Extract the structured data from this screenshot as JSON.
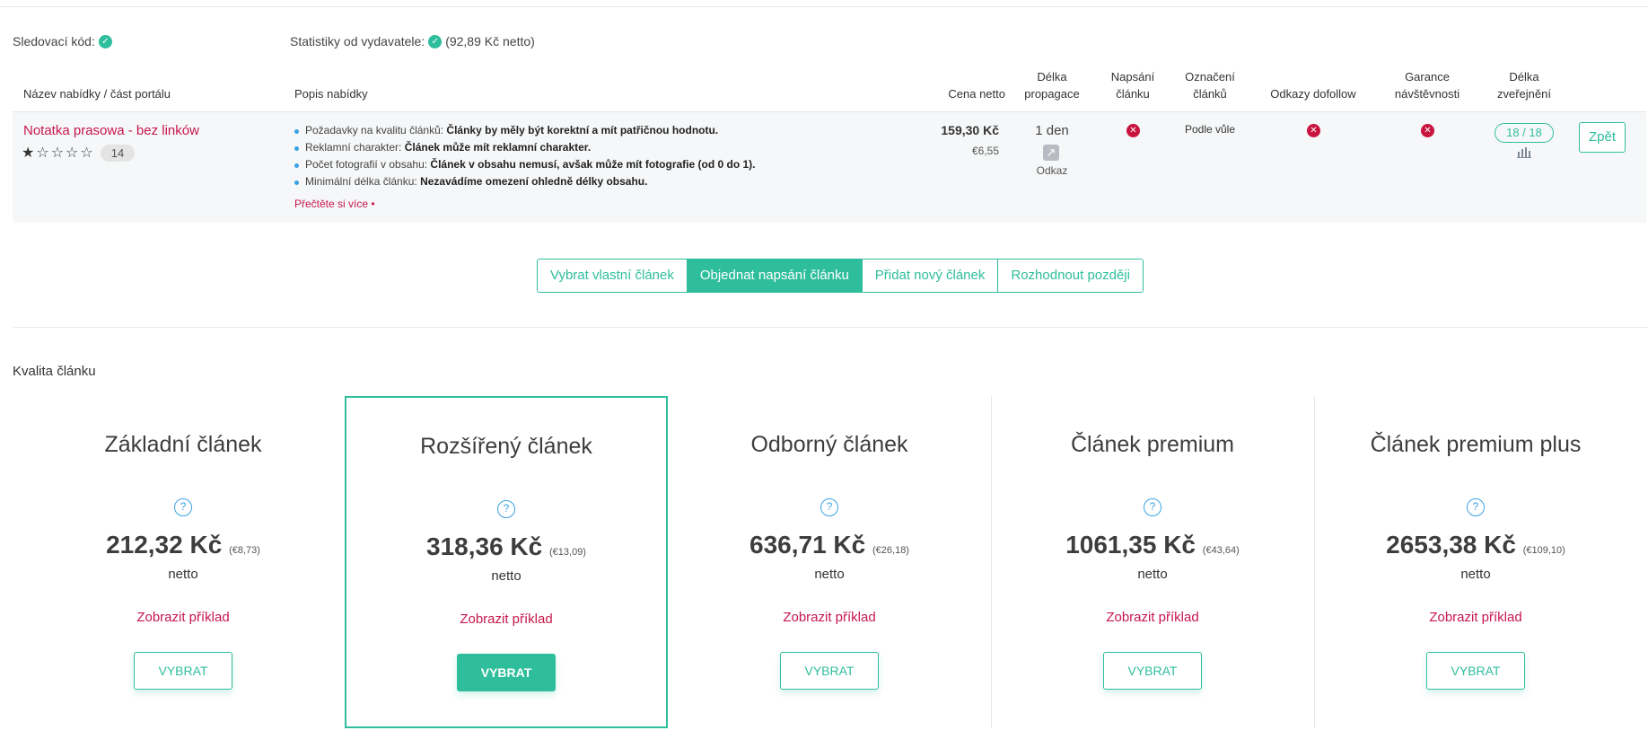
{
  "summary": {
    "tracking_label": "Sledovací kód:",
    "stats_label": "Statistiky od vydavatele:",
    "stats_value": "(92,89 Kč netto)"
  },
  "table": {
    "headers": {
      "name": "Název nabídky / část portálu",
      "description": "Popis nabídky",
      "price": "Cena netto",
      "propagation_1": "Délka",
      "propagation_2": "propagace",
      "writing_1": "Napsání",
      "writing_2": "článku",
      "marking_1": "Označení",
      "marking_2": "článků",
      "dofollow": "Odkazy dofollow",
      "guarantee_1": "Garance",
      "guarantee_2": "návštěvnosti",
      "publish_1": "Délka",
      "publish_2": "zveřejnění"
    },
    "row": {
      "name": "Notatka prasowa - bez linków",
      "rating_count": "14",
      "requirements": [
        {
          "label": "Požadavky na kvalitu článků: ",
          "value": "Články by měly být korektní a mít patřičnou hodnotu."
        },
        {
          "label": "Reklamní charakter: ",
          "value": "Článek může mít reklamní charakter."
        },
        {
          "label": "Počet fotografií v obsahu: ",
          "value": "Článek v obsahu nemusí, avšak může mít fotografie (od 0 do 1)."
        },
        {
          "label": "Minimální délka článku: ",
          "value": "Nezavádíme omezení ohledně délky obsahu."
        }
      ],
      "read_more": "Přečtěte si více •",
      "price": "159,30 Kč",
      "price_eur": "€6,55",
      "propagation_days": "1 den",
      "propagation_type": "Odkaz",
      "marking": "Podle vůle",
      "publish_badge": "18 / 18",
      "back_label": "Zpět"
    }
  },
  "tabs": {
    "own": "Vybrat vlastní článek",
    "order": "Objednat napsání článku",
    "new": "Přidat nový článek",
    "later": "Rozhodnout později"
  },
  "quality": {
    "title": "Kvalita článku",
    "cards": [
      {
        "title": "Základní článek",
        "price": "212,32 Kč",
        "eur": "(€8,73)",
        "netto": "netto",
        "example": "Zobrazit příklad",
        "button": "VYBRAT"
      },
      {
        "title": "Rozšířený článek",
        "price": "318,36 Kč",
        "eur": "(€13,09)",
        "netto": "netto",
        "example": "Zobrazit příklad",
        "button": "VYBRAT"
      },
      {
        "title": "Odborný článek",
        "price": "636,71 Kč",
        "eur": "(€26,18)",
        "netto": "netto",
        "example": "Zobrazit příklad",
        "button": "VYBRAT"
      },
      {
        "title": "Článek premium",
        "price": "1061,35 Kč",
        "eur": "(€43,64)",
        "netto": "netto",
        "example": "Zobrazit příklad",
        "button": "VYBRAT"
      },
      {
        "title": "Článek premium plus",
        "price": "2653,38 Kč",
        "eur": "(€109,10)",
        "netto": "netto",
        "example": "Zobrazit příklad",
        "button": "VYBRAT"
      }
    ]
  },
  "colors": {
    "accent": "#2fbe9c",
    "link": "#c6174d",
    "error": "#c8143e"
  }
}
